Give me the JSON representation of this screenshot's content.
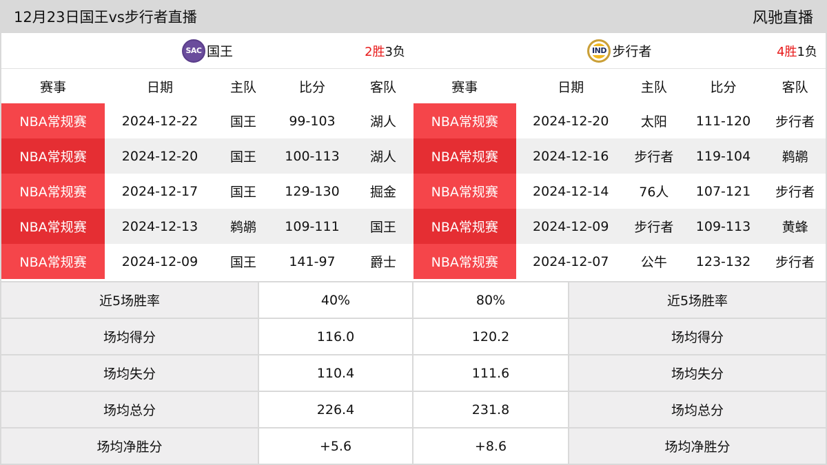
{
  "header": {
    "title": "12月23日国王vs步行者直播",
    "brand": "风驰直播"
  },
  "columns": [
    "赛事",
    "日期",
    "主队",
    "比分",
    "客队"
  ],
  "left_team": {
    "logo_text": "SAC",
    "name": "国王",
    "wins": "2",
    "win_label": "胜",
    "losses": "3",
    "loss_label": "负",
    "games": [
      {
        "competition": "NBA常规赛",
        "date": "2024-12-22",
        "home": "国王",
        "score": "99-103",
        "away": "湖人"
      },
      {
        "competition": "NBA常规赛",
        "date": "2024-12-20",
        "home": "国王",
        "score": "100-113",
        "away": "湖人"
      },
      {
        "competition": "NBA常规赛",
        "date": "2024-12-17",
        "home": "国王",
        "score": "129-130",
        "away": "掘金"
      },
      {
        "competition": "NBA常规赛",
        "date": "2024-12-13",
        "home": "鹈鹕",
        "score": "109-111",
        "away": "国王"
      },
      {
        "competition": "NBA常规赛",
        "date": "2024-12-09",
        "home": "国王",
        "score": "141-97",
        "away": "爵士"
      }
    ]
  },
  "right_team": {
    "logo_text": "IND",
    "name": "步行者",
    "wins": "4",
    "win_label": "胜",
    "losses": "1",
    "loss_label": "负",
    "games": [
      {
        "competition": "NBA常规赛",
        "date": "2024-12-20",
        "home": "太阳",
        "score": "111-120",
        "away": "步行者"
      },
      {
        "competition": "NBA常规赛",
        "date": "2024-12-16",
        "home": "步行者",
        "score": "119-104",
        "away": "鹈鹕"
      },
      {
        "competition": "NBA常规赛",
        "date": "2024-12-14",
        "home": "76人",
        "score": "107-121",
        "away": "步行者"
      },
      {
        "competition": "NBA常规赛",
        "date": "2024-12-09",
        "home": "步行者",
        "score": "109-113",
        "away": "黄蜂"
      },
      {
        "competition": "NBA常规赛",
        "date": "2024-12-07",
        "home": "公牛",
        "score": "123-132",
        "away": "步行者"
      }
    ]
  },
  "stats": [
    {
      "label": "近5场胜率",
      "left": "40%",
      "right": "80%"
    },
    {
      "label": "场均得分",
      "left": "116.0",
      "right": "120.2"
    },
    {
      "label": "场均失分",
      "left": "110.4",
      "right": "111.6"
    },
    {
      "label": "场均总分",
      "left": "226.4",
      "right": "231.8"
    },
    {
      "label": "场均净胜分",
      "left": "+5.6",
      "right": "+8.6"
    }
  ],
  "colors": {
    "win_red": "#e81919",
    "competition_red": "#f5454a",
    "competition_red_alt": "#e52e33",
    "header_gray": "#d9d9d9"
  }
}
